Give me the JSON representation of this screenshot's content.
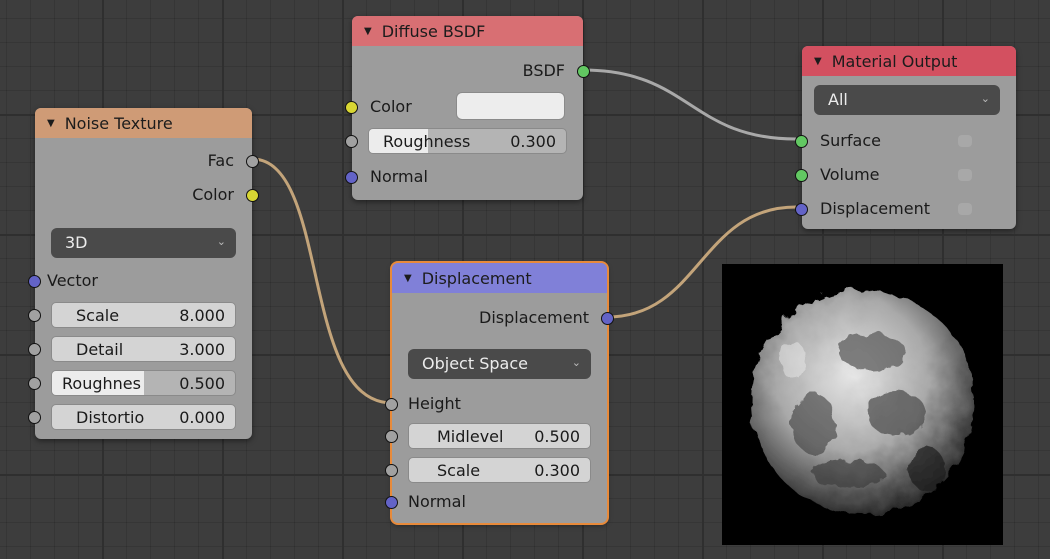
{
  "nodes": {
    "noise_texture": {
      "title": "Noise Texture",
      "outputs": {
        "fac": "Fac",
        "color": "Color"
      },
      "dimension": "3D",
      "input_vector": "Vector",
      "fields": [
        {
          "name": "Scale",
          "value": "8.000"
        },
        {
          "name": "Detail",
          "value": "3.000"
        },
        {
          "name": "Roughnes",
          "value": "0.500",
          "fill_fraction": 0.5
        },
        {
          "name": "Distortio",
          "value": "0.000"
        }
      ]
    },
    "diffuse_bsdf": {
      "title": "Diffuse BSDF",
      "output": "BSDF",
      "color_label": "Color",
      "roughness": {
        "name": "Roughness",
        "value": "0.300",
        "fill_fraction": 0.3
      },
      "normal_label": "Normal"
    },
    "material_output": {
      "title": "Material Output",
      "target": "All",
      "inputs": {
        "surface": "Surface",
        "volume": "Volume",
        "displacement": "Displacement"
      }
    },
    "displacement": {
      "title": "Displacement",
      "output": "Displacement",
      "space": "Object Space",
      "height_label": "Height",
      "fields": [
        {
          "name": "Midlevel",
          "value": "0.500"
        },
        {
          "name": "Scale",
          "value": "0.300"
        }
      ],
      "normal_label": "Normal"
    }
  },
  "colors": {
    "noise_header": "#cf9b76",
    "diffuse_header": "#d86f73",
    "material_header": "#d35060",
    "displacement_header": "#8080d8",
    "socket_float": "#a1a1a1",
    "socket_color": "#d8d633",
    "socket_vector": "#6363c7",
    "socket_shader": "#62c862",
    "active_outline": "#e88a3a"
  },
  "render_preview": {
    "subject": "displaced-noise-sphere"
  }
}
